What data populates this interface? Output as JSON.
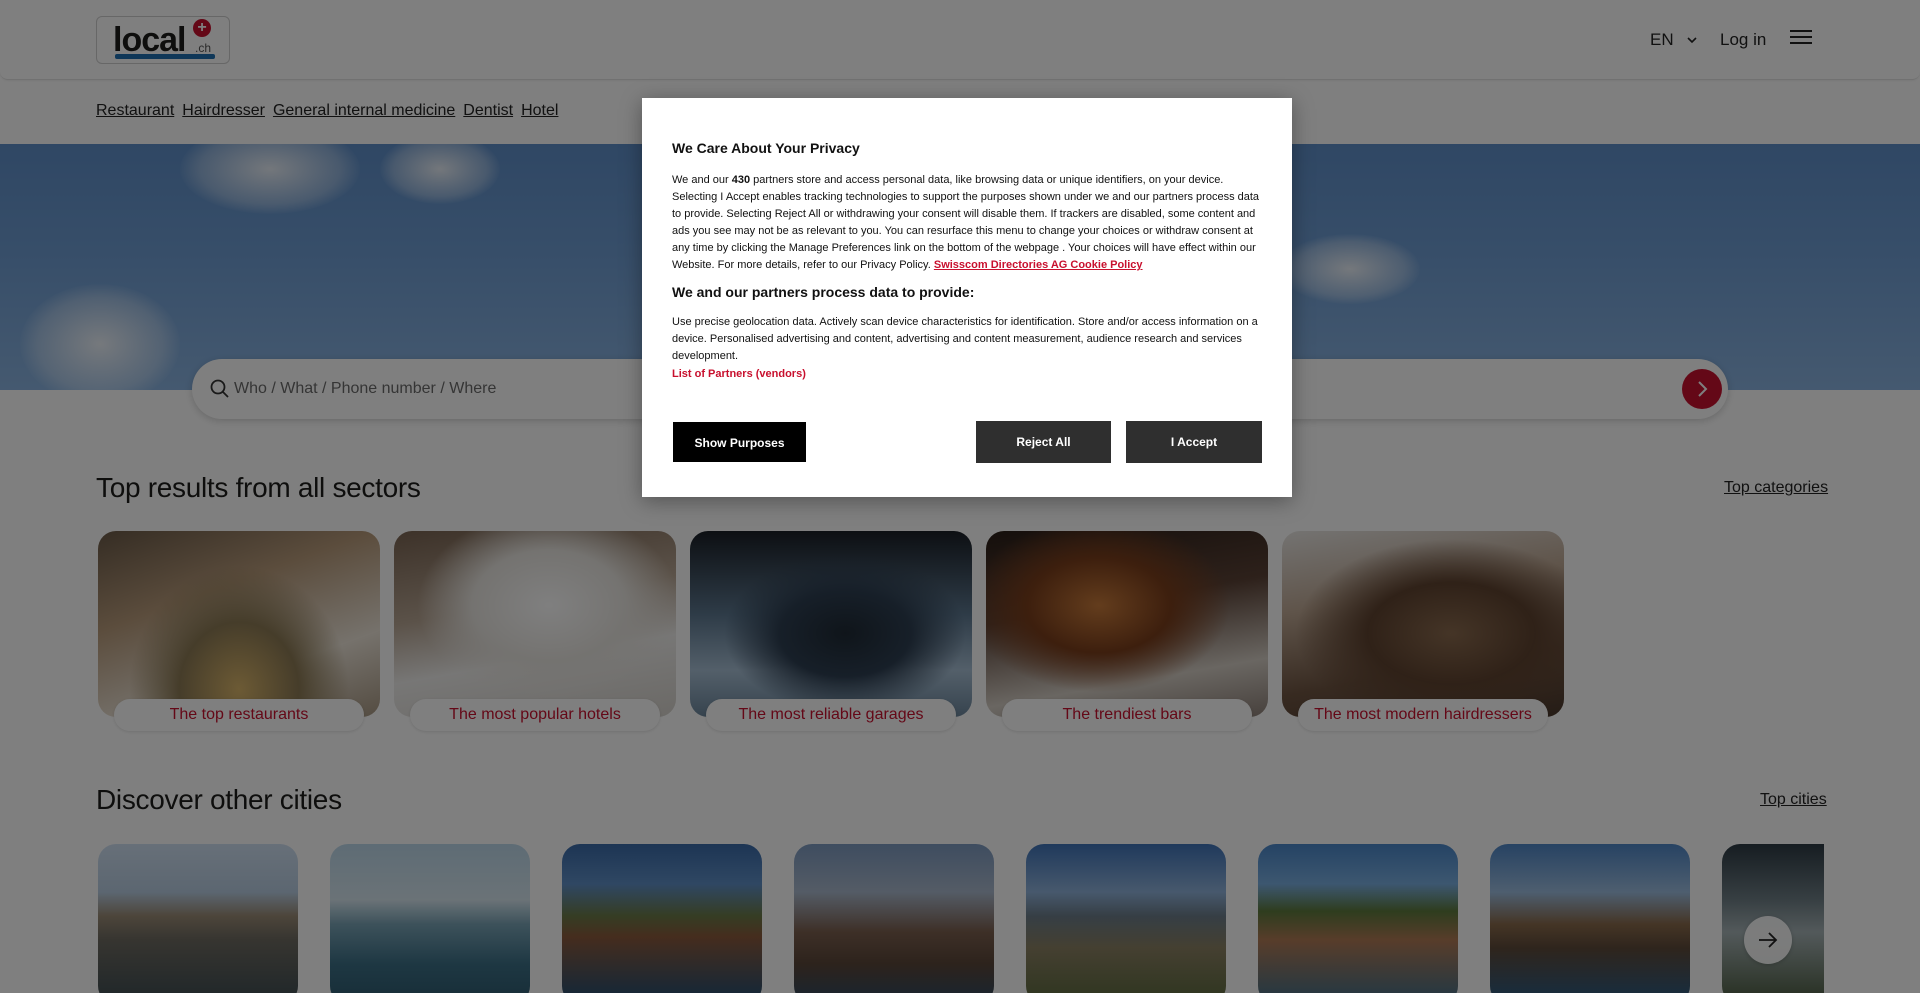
{
  "header": {
    "logo_text": "local",
    "logo_suffix": ".ch",
    "language": "EN",
    "login_label": "Log in"
  },
  "quick_links": [
    "Restaurant",
    "Hairdresser",
    "General internal medicine",
    "Dentist",
    "Hotel"
  ],
  "search": {
    "placeholder": "Who / What / Phone number / Where"
  },
  "sectors": {
    "title": "Top results from all sectors",
    "link": "Top categories",
    "cards": [
      {
        "label": "The top restaurants"
      },
      {
        "label": "The most popular hotels"
      },
      {
        "label": "The most reliable garages"
      },
      {
        "label": "The trendiest bars"
      },
      {
        "label": "The most modern hairdressers"
      }
    ]
  },
  "cities": {
    "title": "Discover other cities",
    "link": "Top cities"
  },
  "consent": {
    "title": "We Care About Your Privacy",
    "body_prefix": "We and our ",
    "partner_count": "430",
    "body_text": " partners store and access personal data, like browsing data or unique identifiers, on your device. Selecting I Accept enables tracking technologies to support the purposes shown under we and our partners process data to provide. Selecting Reject All or withdrawing your consent will disable them. If trackers are disabled, some content and ads you see may not be as relevant to you. You can resurface this menu to change your choices or withdraw consent at any time by clicking the Manage Preferences link on the bottom of the webpage . Your choices will have effect within our Website. For more details, refer to our Privacy Policy. ",
    "policy_link": "Swisscom Directories AG Cookie Policy",
    "subtitle": "We and our partners process data to provide:",
    "purposes": "Use precise geolocation data. Actively scan device characteristics for identification. Store and/or access information on a device. Personalised advertising and content, advertising and content measurement, audience research and services development.",
    "vendors_link": "List of Partners (vendors)",
    "show_purposes": "Show Purposes",
    "reject_all": "Reject All",
    "accept": "I Accept"
  },
  "colors": {
    "brand_red": "#c8102e",
    "sky_blue": "#6f9dd3"
  }
}
